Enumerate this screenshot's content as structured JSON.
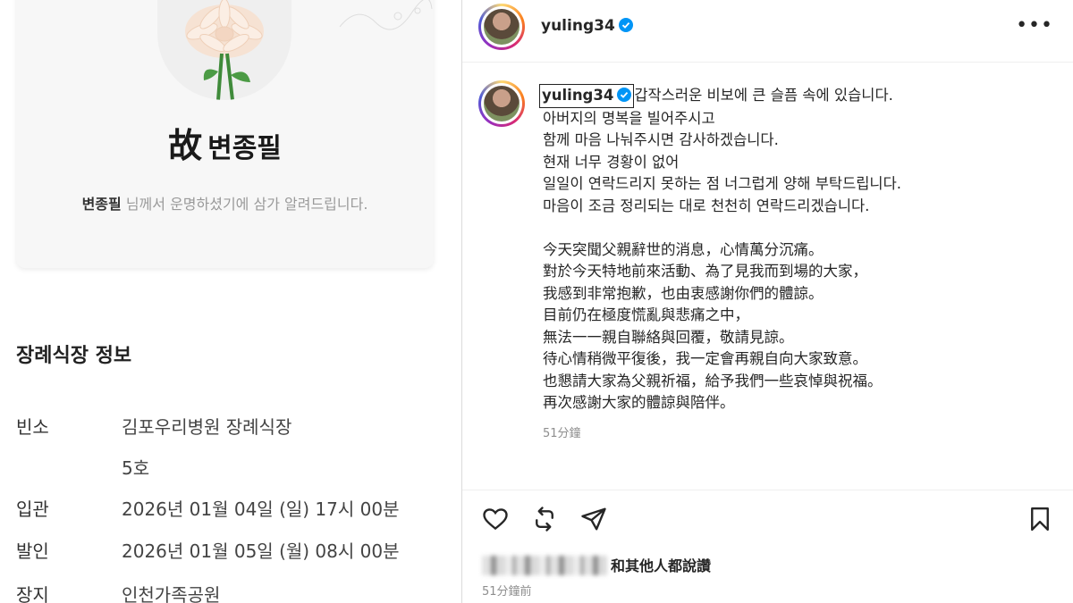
{
  "obituary": {
    "deceased_hanja": "故",
    "deceased_name": "변종필",
    "notice_name": "변종필",
    "notice_text": " 님께서 운명하셨기에 삼가 알려드립니다.",
    "section_title": "장례식장 정보",
    "rows": [
      {
        "label": "빈소",
        "value": "김포우리병원 장례식장"
      },
      {
        "label": "",
        "value": "5호"
      },
      {
        "label": "입관",
        "value": "2026년 01월 04일 (일) 17시 00분"
      },
      {
        "label": "발인",
        "value": "2026년 01월 05일 (월) 08시 00분"
      },
      {
        "label": "장지",
        "value": "인천가족공원"
      }
    ]
  },
  "post": {
    "username": "yuling34",
    "verified_color": "#0095f6",
    "more_label": "•••",
    "caption_first": "갑작스러운 비보에 큰 슬픔 속에 있습니다.",
    "caption_lines": [
      "아버지의 명복을 빌어주시고",
      "함께 마음 나눠주시면 감사하겠습니다.",
      "현재 너무 경황이 없어",
      "일일이 연락드리지 못하는 점 너그럽게 양해 부탁드립니다.",
      "마음이 조금 정리되는 대로 천천히 연락드리겠습니다.",
      "",
      "今天突聞父親辭世的消息，心情萬分沉痛。",
      "對於今天特地前來活動、為了見我而到場的大家，",
      "我感到非常抱歉，也由衷感謝你們的體諒。",
      "目前仍在極度慌亂與悲痛之中，",
      "無法一一親自聯絡與回覆，敬請見諒。",
      "待心情稍微平復後，我一定會再親自向大家致意。",
      "也懇請大家為父親祈福，給予我們一些哀悼與祝福。",
      "再次感謝大家的體諒與陪伴。"
    ],
    "caption_time": "51分鐘",
    "likes_text": "和其他人都說讚",
    "post_time": "51分鐘前",
    "icons": [
      "heart-icon",
      "repost-icon",
      "share-icon",
      "bookmark-icon"
    ]
  }
}
